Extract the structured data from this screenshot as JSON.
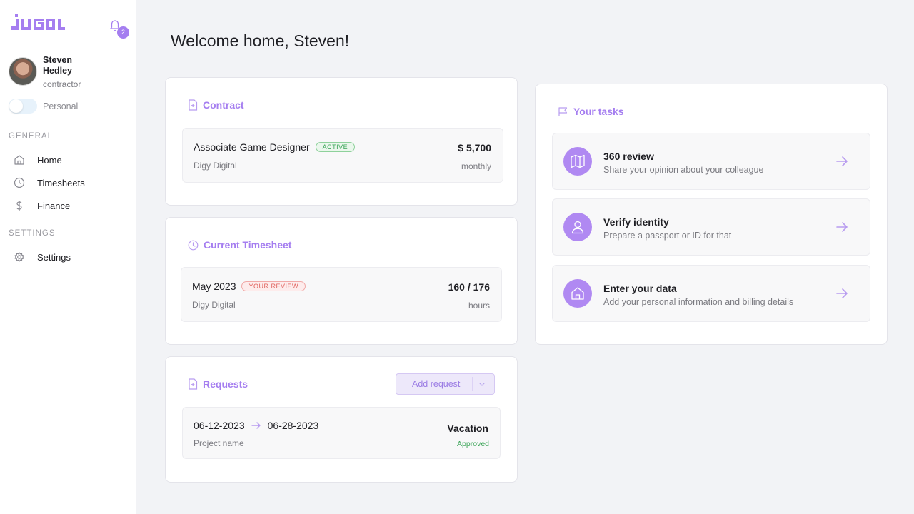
{
  "app": {
    "logo_text": "JUGL"
  },
  "notifications": {
    "count": "2"
  },
  "user": {
    "name": "Steven Hedley",
    "role": "contractor"
  },
  "mode": {
    "label": "Personal",
    "enabled": false
  },
  "sidebar": {
    "general_label": "GENERAL",
    "settings_label": "SETTINGS",
    "items": [
      {
        "label": "Home",
        "icon": "home-icon"
      },
      {
        "label": "Timesheets",
        "icon": "clock-icon"
      },
      {
        "label": "Finance",
        "icon": "dollar-icon"
      }
    ],
    "settings_items": [
      {
        "label": "Settings",
        "icon": "gear-icon"
      }
    ]
  },
  "welcome": "Welcome home, Steven!",
  "contract": {
    "title": "Contract",
    "role": "Associate Game Designer",
    "status": "ACTIVE",
    "company": "Digy Digital",
    "amount": "$ 5,700",
    "period": "monthly"
  },
  "timesheet": {
    "title": "Current Timesheet",
    "month": "May 2023",
    "status": "YOUR REVIEW",
    "company": "Digy Digital",
    "hours": "160 / 176",
    "unit": "hours"
  },
  "requests": {
    "title": "Requests",
    "add_label": "Add request",
    "items": [
      {
        "from": "06-12-2023",
        "to": "06-28-2023",
        "project": "Project name",
        "type": "Vacation",
        "status": "Approved"
      }
    ]
  },
  "tasks": {
    "title": "Your tasks",
    "items": [
      {
        "title": "360 review",
        "description": "Share your opinion about your colleague",
        "icon": "map-icon"
      },
      {
        "title": "Verify identity",
        "description": "Prepare a passport or ID for that",
        "icon": "user-icon"
      },
      {
        "title": "Enter your data",
        "description": "Add your personal information and billing details",
        "icon": "house-icon"
      }
    ]
  },
  "colors": {
    "accent": "#a57ef0",
    "background": "#f2f3f6",
    "success": "#3aa457",
    "warning": "#e0625e"
  }
}
